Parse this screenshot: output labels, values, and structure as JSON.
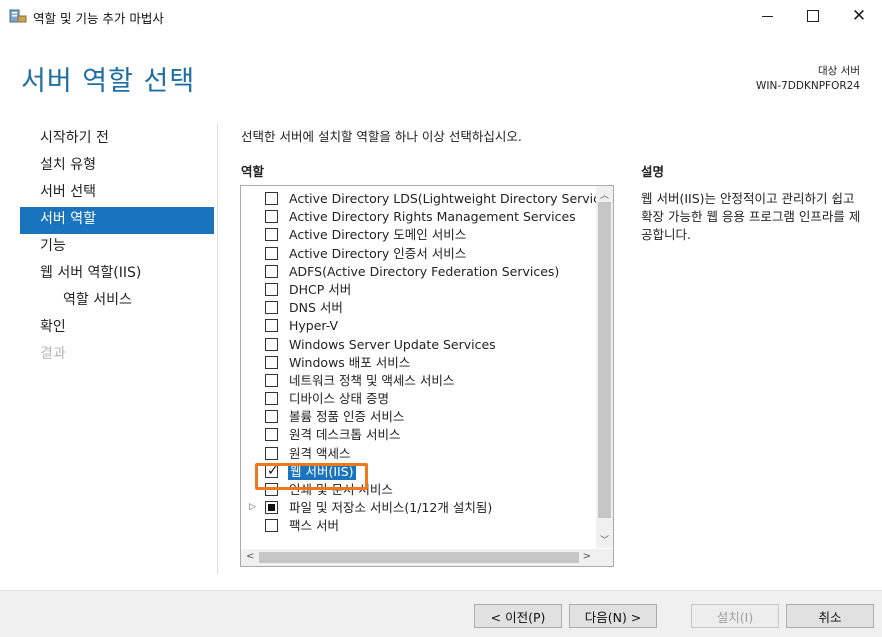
{
  "window": {
    "title": "역할 및 기능 추가 마법사",
    "controls": {
      "minimize": "minimize-icon",
      "maximize": "maximize-icon",
      "close": "close-icon"
    }
  },
  "header": {
    "page_title": "서버 역할 선택",
    "destination_label": "대상 서버",
    "destination_server": "WIN-7DDKNPFOR24"
  },
  "nav": {
    "items": [
      {
        "label": "시작하기 전",
        "state": "normal"
      },
      {
        "label": "설치 유형",
        "state": "normal"
      },
      {
        "label": "서버 선택",
        "state": "normal"
      },
      {
        "label": "서버 역할",
        "state": "active"
      },
      {
        "label": "기능",
        "state": "normal"
      },
      {
        "label": "웹 서버 역할(IIS)",
        "state": "normal"
      },
      {
        "label": "역할 서비스",
        "state": "sub"
      },
      {
        "label": "확인",
        "state": "normal"
      },
      {
        "label": "결과",
        "state": "disabled"
      }
    ]
  },
  "main": {
    "instruction": "선택한 서버에 설치할 역할을 하나 이상 선택하십시오.",
    "roles_header": "역할",
    "roles": [
      {
        "label": "Active Directory LDS(Lightweight Directory Servic",
        "checked": false
      },
      {
        "label": "Active Directory Rights Management Services",
        "checked": false
      },
      {
        "label": "Active Directory 도메인 서비스",
        "checked": false
      },
      {
        "label": "Active Directory 인증서 서비스",
        "checked": false
      },
      {
        "label": "ADFS(Active Directory Federation Services)",
        "checked": false
      },
      {
        "label": "DHCP 서버",
        "checked": false
      },
      {
        "label": "DNS 서버",
        "checked": false
      },
      {
        "label": "Hyper-V",
        "checked": false
      },
      {
        "label": "Windows Server Update Services",
        "checked": false
      },
      {
        "label": "Windows 배포 서비스",
        "checked": false
      },
      {
        "label": "네트워크 정책 및 액세스 서비스",
        "checked": false
      },
      {
        "label": "디바이스 상태 증명",
        "checked": false
      },
      {
        "label": "볼륨 정품 인증 서비스",
        "checked": false
      },
      {
        "label": "원격 데스크톱 서비스",
        "checked": false
      },
      {
        "label": "원격 액세스",
        "checked": false
      },
      {
        "label": "웹 서버(IIS)",
        "checked": true,
        "selected": true
      },
      {
        "label": "인쇄 및 문서 서비스",
        "checked": false
      },
      {
        "label": "파일 및 저장소 서비스(1/12개 설치됨)",
        "checked": "partial",
        "expandable": true
      },
      {
        "label": "팩스 서버",
        "checked": false
      }
    ],
    "description_header": "설명",
    "description": "웹 서버(IIS)는 안정적이고 관리하기 쉽고 확장 가능한 웹 응용 프로그램 인프라를 제공합니다."
  },
  "footer": {
    "prev_label": "< 이전(P)",
    "next_label": "다음(N) >",
    "install_label": "설치(I)",
    "cancel_label": "취소"
  },
  "colors": {
    "accent": "#1a74bd",
    "title_blue": "#1f6fa3",
    "highlight_orange": "#f0771b"
  }
}
